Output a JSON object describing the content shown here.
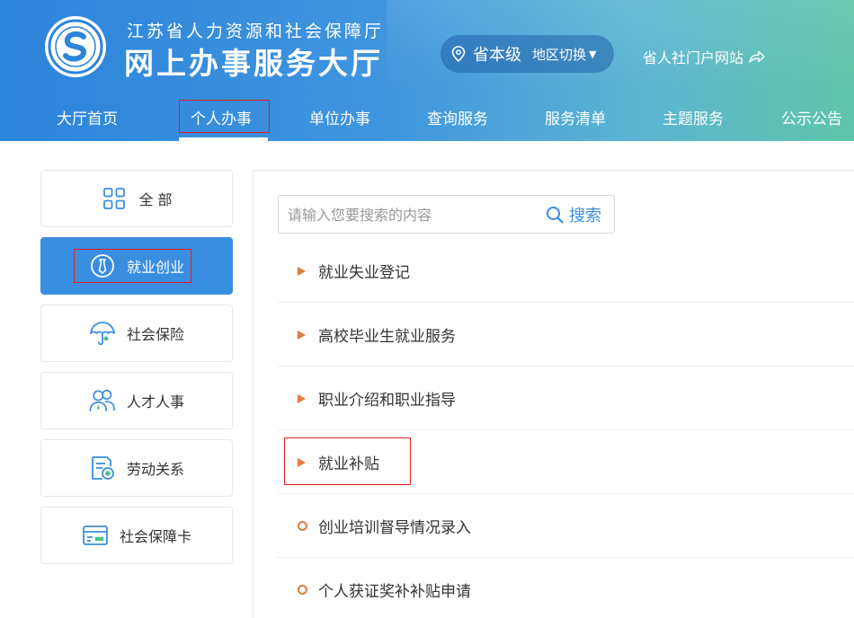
{
  "header": {
    "org_name": "江苏省人力资源和社会保障厅",
    "site_name": "网上办事服务大厅",
    "region_level": "省本级",
    "region_switch": "地区切换",
    "portal_link": "省人社门户网站"
  },
  "nav": {
    "items": [
      "大厅首页",
      "个人办事",
      "单位办事",
      "查询服务",
      "服务清单",
      "主题服务",
      "公示公告"
    ],
    "active_index": 1
  },
  "sidebar": {
    "items": [
      {
        "label": "全 部",
        "icon": "grid-icon"
      },
      {
        "label": "就业创业",
        "icon": "tie-icon",
        "active": true
      },
      {
        "label": "社会保险",
        "icon": "umbrella-icon"
      },
      {
        "label": "人才人事",
        "icon": "people-icon"
      },
      {
        "label": "劳动关系",
        "icon": "document-badge-icon"
      },
      {
        "label": "社会保障卡",
        "icon": "card-icon"
      }
    ]
  },
  "search": {
    "placeholder": "请输入您要搜索的内容",
    "button_label": "搜索"
  },
  "services": [
    {
      "label": "就业失业登记",
      "marker": "triangle"
    },
    {
      "label": "高校毕业生就业服务",
      "marker": "triangle"
    },
    {
      "label": "职业介绍和职业指导",
      "marker": "triangle"
    },
    {
      "label": "就业补贴",
      "marker": "triangle"
    },
    {
      "label": "创业培训督导情况录入",
      "marker": "ring"
    },
    {
      "label": "个人获证奖补补贴申请",
      "marker": "ring"
    }
  ],
  "colors": {
    "header_blue": "#2c84db",
    "header_green": "#5ec5a8",
    "active_blue": "#3a8ee0",
    "marker_orange": "#e27b3d",
    "highlight_red": "#e02020"
  }
}
